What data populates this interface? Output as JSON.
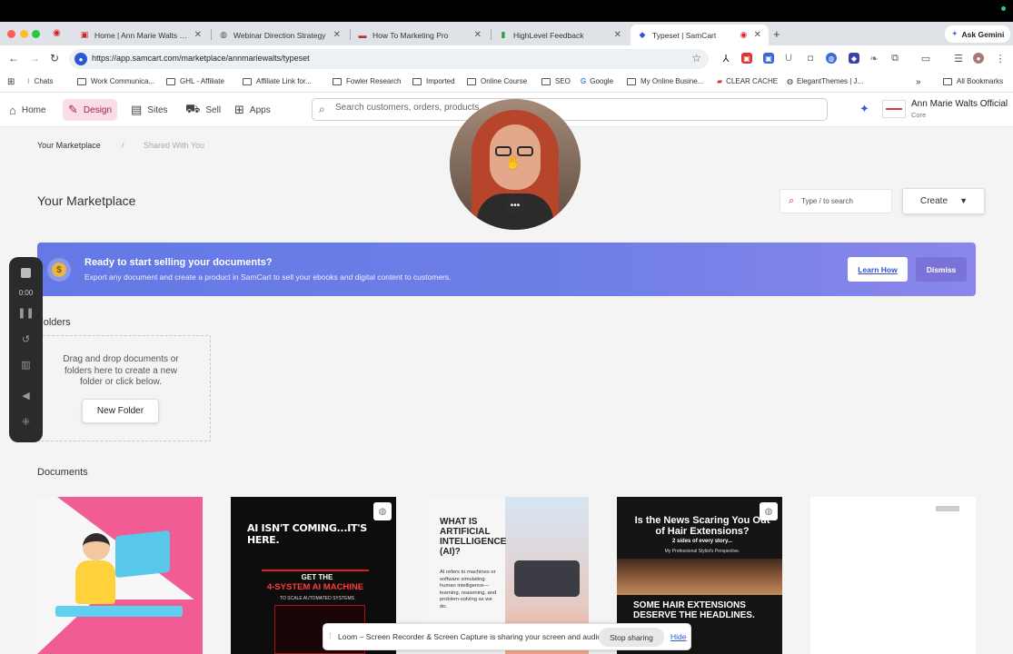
{
  "browser": {
    "tabs": [
      {
        "label": "Home | Ann Marie Walts Mark",
        "favicon": "stop-record-icon"
      },
      {
        "label": "Webinar Direction Strategy",
        "favicon": "globe-icon"
      },
      {
        "label": "How To Marketing Pro",
        "favicon": "flag-icon"
      },
      {
        "label": "HighLevel Feedback",
        "favicon": "chart-icon"
      },
      {
        "label": "Typeset | SamCart",
        "favicon": "samcart-icon"
      }
    ],
    "ask_gemini": "Ask Gemini",
    "url": "https://app.samcart.com/marketplace/annmariewalts/typeset",
    "bookmarks": [
      {
        "label": "Chats",
        "icon": "apps-icon"
      },
      {
        "label": "Work Communica...",
        "icon": "folder-icon"
      },
      {
        "label": "GHL - Affiliate",
        "icon": "folder-icon"
      },
      {
        "label": "Affiliate Link for...",
        "icon": "folder-icon"
      },
      {
        "label": "Fowler Research",
        "icon": "folder-icon"
      },
      {
        "label": "Imported",
        "icon": "folder-icon"
      },
      {
        "label": "Online Course",
        "icon": "folder-icon"
      },
      {
        "label": "SEO",
        "icon": "folder-icon"
      },
      {
        "label": "Google",
        "icon": "google-icon"
      },
      {
        "label": "My Online Busine...",
        "icon": "folder-icon"
      },
      {
        "label": "CLEAR CACHE",
        "icon": "cache-icon"
      },
      {
        "label": "ElegantThemes | J...",
        "icon": "globe-icon"
      }
    ],
    "all_bookmarks": "All Bookmarks",
    "more_bookmarks": "»"
  },
  "app": {
    "nav": {
      "home": "Home",
      "design": "Design",
      "sites": "Sites",
      "sell": "Sell",
      "apps": "Apps"
    },
    "search_placeholder": "Search customers, orders, products, ...",
    "account_name": "Ann Marie Walts Official",
    "account_plan": "Core"
  },
  "page": {
    "breadcrumb_active": "Your Marketplace",
    "breadcrumb_sep": "/",
    "breadcrumb_other": "Shared With You",
    "title": "Your Marketplace",
    "type_search_placeholder": "Type  /  to search",
    "create_label": "Create",
    "banner": {
      "title": "Ready to start selling your documents?",
      "subtitle": "Export any document and create a product in SamCart to sell your ebooks and digital content to customers.",
      "learn_how": "Learn How",
      "dismiss": "Dismiss"
    },
    "folders_title": "Folders",
    "dropzone_text": "Drag and drop documents or folders here to create a new folder or click below.",
    "new_folder": "New Folder",
    "documents_title": "Documents",
    "documents": [
      {
        "kind": "illustration"
      },
      {
        "heading": "AI ISN'T COMING...IT'S HERE.",
        "line1": "GET THE",
        "line2": "4-SYSTEM AI MACHINE",
        "line3": "TO SCALE AUTOMATED SYSTEMS"
      },
      {
        "heading": "WHAT IS ARTIFICIAL INTELLIGENCE (AI)?",
        "body": "AI refers to machines or software simulating human intelligence—learning, reasoning, and problem-solving as we do."
      },
      {
        "heading": "Is the News Scaring You Out of Hair Extensions?",
        "line1": "2 sides of every story...",
        "line2": "My Professional Stylist's Perspective.",
        "heading2": "SOME HAIR EXTENSIONS DESERVE THE HEADLINES."
      },
      {
        "kind": "blank"
      }
    ]
  },
  "loom": {
    "timer": "0:00",
    "share_message": "Loom – Screen Recorder & Screen Capture is sharing your screen and audio.",
    "stop_sharing": "Stop sharing",
    "hide": "Hide"
  },
  "colors": {
    "banner_start": "#6479e6",
    "banner_end": "#8b86ea",
    "design_active_bg": "#fadde5",
    "design_active_text": "#a2234b"
  }
}
